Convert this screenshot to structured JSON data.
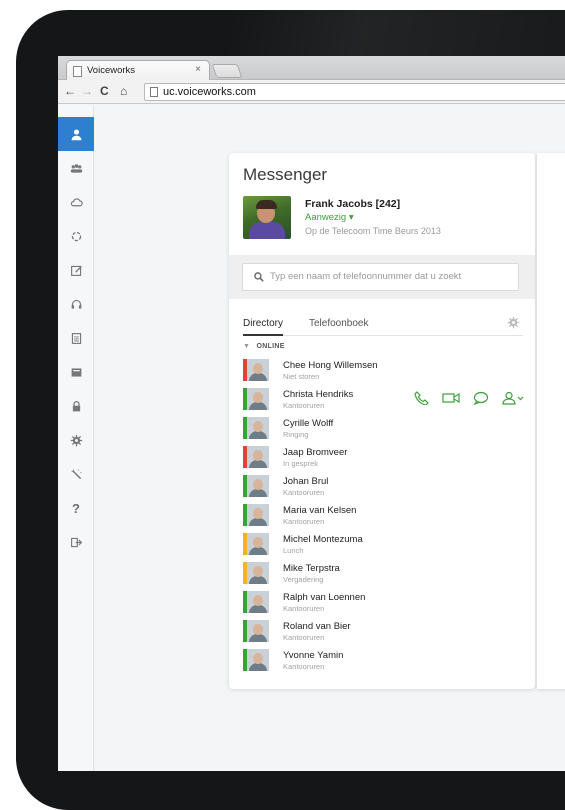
{
  "browser": {
    "tab_title": "Voiceworks",
    "tab_close": "×",
    "url": "uc.voiceworks.com"
  },
  "sidebar": {
    "items": [
      {
        "icon": "user-icon",
        "active": true
      },
      {
        "icon": "contacts-icon"
      },
      {
        "icon": "cloud-icon"
      },
      {
        "icon": "settings-ring-icon"
      },
      {
        "icon": "edit-icon"
      },
      {
        "icon": "headset-icon"
      },
      {
        "icon": "document-icon"
      },
      {
        "icon": "folder-icon"
      },
      {
        "icon": "lock-icon"
      },
      {
        "icon": "gear-icon"
      },
      {
        "icon": "magic-wand-icon"
      },
      {
        "icon": "help-icon"
      },
      {
        "icon": "logout-icon"
      }
    ]
  },
  "messenger": {
    "title": "Messenger",
    "me": {
      "name": "Frank Jacobs [242]",
      "status": "Aanwezig ▾",
      "note": "Op de Telecoom Time Beurs 2013"
    },
    "search_placeholder": "Typ een naam of telefoonnummer dat u zoekt",
    "tabs": {
      "directory": "Directory",
      "telefoonboek": "Telefoonboek"
    },
    "section_label": "ONLINE",
    "section_arrow": "▼",
    "colors": {
      "green": "#3aa13a",
      "red": "#e0413b",
      "yellow": "#f2b51e",
      "accent": "#2e7fd0"
    },
    "contacts": [
      {
        "name": "Chee Hong Willemsen",
        "status": "Niet storen",
        "color": "#e0413b"
      },
      {
        "name": "Christa Hendriks",
        "status": "Kantooruren",
        "color": "#3aa13a"
      },
      {
        "name": "Cyrille Wolff",
        "status": "Ringing",
        "color": "#3aa13a"
      },
      {
        "name": "Jaap Bromveer",
        "status": "In gesprek",
        "color": "#e0413b"
      },
      {
        "name": "Johan Brul",
        "status": "Kantooruren",
        "color": "#3aa13a"
      },
      {
        "name": "Maria van Kelsen",
        "status": "Kantooruren",
        "color": "#3aa13a"
      },
      {
        "name": "Michel Montezuma",
        "status": "Lunch",
        "color": "#f2b51e"
      },
      {
        "name": "Mike Terpstra",
        "status": "Vergadering",
        "color": "#f2b51e"
      },
      {
        "name": "Ralph van Loennen",
        "status": "Kantooruren",
        "color": "#3aa13a"
      },
      {
        "name": "Roland van Bier",
        "status": "Kantooruren",
        "color": "#3aa13a"
      },
      {
        "name": "Yvonne Yamin",
        "status": "Kantooruren",
        "color": "#3aa13a"
      }
    ]
  }
}
